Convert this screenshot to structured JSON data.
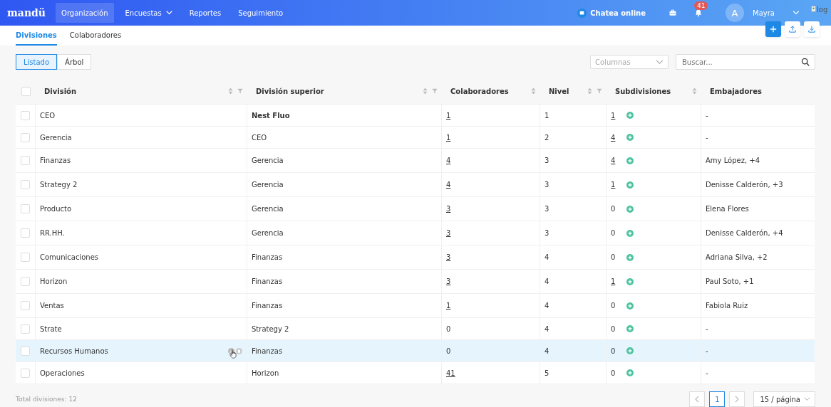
{
  "nav": {
    "logo": "mandü",
    "items": [
      {
        "label": "Organización",
        "selected": true,
        "dropdown": false
      },
      {
        "label": "Encuestas",
        "selected": false,
        "dropdown": true
      },
      {
        "label": "Reportes",
        "selected": false,
        "dropdown": false
      },
      {
        "label": "Seguimiento",
        "selected": false,
        "dropdown": false
      }
    ],
    "chat": "Chatea online",
    "notifications": "41",
    "avatar": "A",
    "user": "Mayra",
    "logo_alt": "log"
  },
  "tabs": [
    {
      "label": "Divisiones",
      "selected": true
    },
    {
      "label": "Colaboradores",
      "selected": false
    }
  ],
  "views": [
    {
      "label": "Listado",
      "selected": true
    },
    {
      "label": "Árbol",
      "selected": false
    }
  ],
  "columns_select": {
    "placeholder": "Columnas"
  },
  "search": {
    "placeholder": "Buscar..."
  },
  "table": {
    "select_all_checked": false,
    "columns": [
      {
        "label": "División",
        "sort": true,
        "filter": true
      },
      {
        "label": "División superior",
        "sort": true,
        "filter": true
      },
      {
        "label": "Colaboradores",
        "sort": true,
        "filter": false
      },
      {
        "label": "Nivel",
        "sort": true,
        "filter": true
      },
      {
        "label": "Subdivisiones",
        "sort": true,
        "filter": false
      },
      {
        "label": "Embajadores",
        "sort": false,
        "filter": false
      }
    ],
    "rows": [
      {
        "division": "CEO",
        "parent": "Nest Fluo",
        "parent_bold": true,
        "collaborators": "1",
        "collaborators_link": true,
        "level": "1",
        "subdivisions": "1",
        "subdivisions_link": true,
        "ambassadors": "-",
        "hovered": false,
        "checked": false
      },
      {
        "division": "Gerencia",
        "parent": "CEO",
        "parent_bold": false,
        "collaborators": "1",
        "collaborators_link": true,
        "level": "2",
        "subdivisions": "4",
        "subdivisions_link": true,
        "ambassadors": "-",
        "hovered": false,
        "checked": false
      },
      {
        "division": "Finanzas",
        "parent": "Gerencia",
        "parent_bold": false,
        "collaborators": "4",
        "collaborators_link": true,
        "level": "3",
        "subdivisions": "4",
        "subdivisions_link": true,
        "ambassadors": "Amy López, +4",
        "hovered": false,
        "checked": false
      },
      {
        "division": "Strategy 2",
        "parent": "Gerencia",
        "parent_bold": false,
        "collaborators": "4",
        "collaborators_link": true,
        "level": "3",
        "subdivisions": "1",
        "subdivisions_link": true,
        "ambassadors": "Denisse Calderón, +3",
        "hovered": false,
        "checked": false
      },
      {
        "division": "Producto",
        "parent": "Gerencia",
        "parent_bold": false,
        "collaborators": "3",
        "collaborators_link": true,
        "level": "3",
        "subdivisions": "0",
        "subdivisions_link": false,
        "ambassadors": "Elena Flores",
        "hovered": false,
        "checked": false
      },
      {
        "division": "RR.HH.",
        "parent": "Gerencia",
        "parent_bold": false,
        "collaborators": "3",
        "collaborators_link": true,
        "level": "3",
        "subdivisions": "0",
        "subdivisions_link": false,
        "ambassadors": "Denisse Calderón, +4",
        "hovered": false,
        "checked": false
      },
      {
        "division": "Comunicaciones",
        "parent": "Finanzas",
        "parent_bold": false,
        "collaborators": "3",
        "collaborators_link": true,
        "level": "4",
        "subdivisions": "0",
        "subdivisions_link": false,
        "ambassadors": "Adriana Silva, +2",
        "hovered": false,
        "checked": false
      },
      {
        "division": "Horizon",
        "parent": "Finanzas",
        "parent_bold": false,
        "collaborators": "3",
        "collaborators_link": true,
        "level": "4",
        "subdivisions": "1",
        "subdivisions_link": true,
        "ambassadors": "Paul Soto, +1",
        "hovered": false,
        "checked": false
      },
      {
        "division": "Ventas",
        "parent": "Finanzas",
        "parent_bold": false,
        "collaborators": "1",
        "collaborators_link": true,
        "level": "4",
        "subdivisions": "0",
        "subdivisions_link": false,
        "ambassadors": "Fabiola Ruiz",
        "hovered": false,
        "checked": false
      },
      {
        "division": "Strate",
        "parent": "Strategy 2",
        "parent_bold": false,
        "collaborators": "0",
        "collaborators_link": false,
        "level": "4",
        "subdivisions": "0",
        "subdivisions_link": false,
        "ambassadors": "-",
        "hovered": false,
        "checked": false
      },
      {
        "division": "Recursos Humanos",
        "parent": "Finanzas",
        "parent_bold": false,
        "collaborators": "0",
        "collaborators_link": false,
        "level": "4",
        "subdivisions": "0",
        "subdivisions_link": false,
        "ambassadors": "-",
        "hovered": true,
        "checked": false
      },
      {
        "division": "Operaciones",
        "parent": "Horizon",
        "parent_bold": false,
        "collaborators": "41",
        "collaborators_link": true,
        "level": "5",
        "subdivisions": "0",
        "subdivisions_link": false,
        "ambassadors": "-",
        "hovered": false,
        "checked": false
      }
    ]
  },
  "footer": {
    "total": "Total divisiones: 12",
    "pages": [
      {
        "label": "1",
        "selected": true
      }
    ],
    "page_size": "15 / página"
  }
}
